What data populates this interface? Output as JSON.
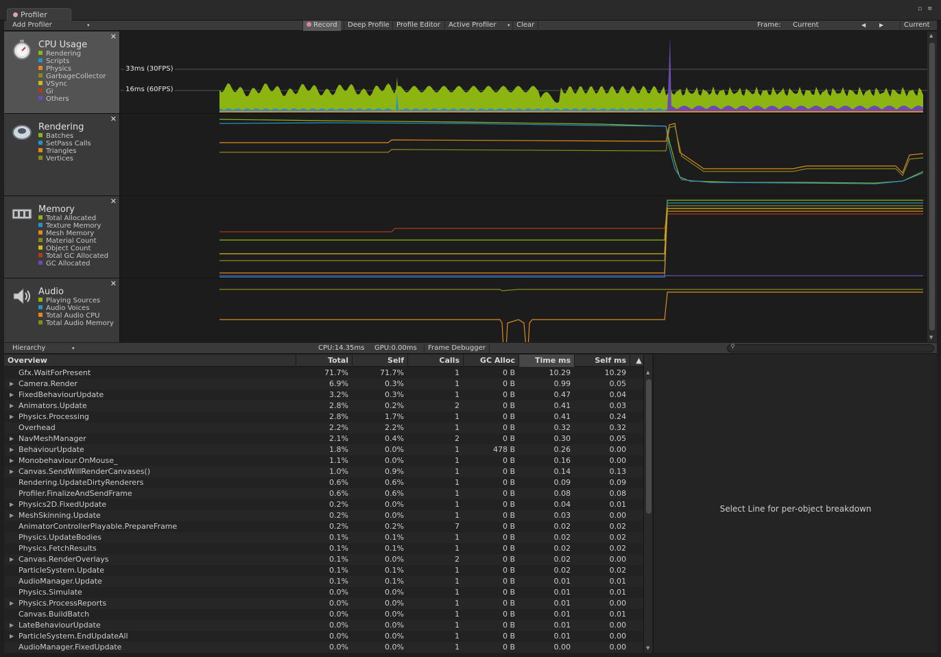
{
  "window": {
    "tab_title": "Profiler"
  },
  "toolbar": {
    "add_profiler": "Add Profiler",
    "record": "Record",
    "deep_profile": "Deep Profile",
    "profile_editor": "Profile Editor",
    "active_profiler": "Active Profiler",
    "clear": "Clear",
    "frame_label": "Frame:",
    "frame_value": "Current",
    "current_button": "Current"
  },
  "colors": {
    "green": "#8db512",
    "blue": "#2b8fc9",
    "orange": "#e08a1c",
    "olive": "#8a8a1a",
    "yellow": "#d4b81a",
    "red": "#b03a1a",
    "purple": "#6a4bb0"
  },
  "areas": [
    {
      "title": "CPU Usage",
      "icon": "cpu-stopwatch-icon",
      "items": [
        {
          "label": "Rendering",
          "color": "#8db512"
        },
        {
          "label": "Scripts",
          "color": "#2b8fc9"
        },
        {
          "label": "Physics",
          "color": "#e08a1c"
        },
        {
          "label": "GarbageCollector",
          "color": "#8a8a1a"
        },
        {
          "label": "VSync",
          "color": "#d4b81a"
        },
        {
          "label": "Gi",
          "color": "#b03a1a"
        },
        {
          "label": "Others",
          "color": "#6a4bb0"
        }
      ]
    },
    {
      "title": "Rendering",
      "icon": "rendering-icon",
      "items": [
        {
          "label": "Batches",
          "color": "#8db512"
        },
        {
          "label": "SetPass Calls",
          "color": "#2b8fc9"
        },
        {
          "label": "Triangles",
          "color": "#e08a1c"
        },
        {
          "label": "Vertices",
          "color": "#8a8a1a"
        }
      ]
    },
    {
      "title": "Memory",
      "icon": "memory-chip-icon",
      "items": [
        {
          "label": "Total Allocated",
          "color": "#8db512"
        },
        {
          "label": "Texture Memory",
          "color": "#2b8fc9"
        },
        {
          "label": "Mesh Memory",
          "color": "#e08a1c"
        },
        {
          "label": "Material Count",
          "color": "#8a8a1a"
        },
        {
          "label": "Object Count",
          "color": "#d4b81a"
        },
        {
          "label": "Total GC Allocated",
          "color": "#b03a1a"
        },
        {
          "label": "GC Allocated",
          "color": "#6a4bb0"
        }
      ]
    },
    {
      "title": "Audio",
      "icon": "speaker-icon",
      "items": [
        {
          "label": "Playing Sources",
          "color": "#8db512"
        },
        {
          "label": "Audio Voices",
          "color": "#2b8fc9"
        },
        {
          "label": "Total Audio CPU",
          "color": "#e08a1c"
        },
        {
          "label": "Total Audio Memory",
          "color": "#8a8a1a"
        }
      ]
    }
  ],
  "fps_lines": {
    "line_30": "33ms (30FPS)",
    "line_60": "16ms (60FPS)"
  },
  "hierarchy": {
    "view_mode": "Hierarchy",
    "cpu_stat": "CPU:14.35ms",
    "gpu_stat": "GPU:0.00ms",
    "frame_debugger": "Frame Debugger",
    "columns": [
      "Overview",
      "Total",
      "Self",
      "Calls",
      "GC Alloc",
      "Time ms",
      "Self ms"
    ],
    "rows": [
      {
        "expand": false,
        "name": "Gfx.WaitForPresent",
        "total": "71.7%",
        "self": "71.7%",
        "calls": "1",
        "gc": "0 B",
        "time": "10.29",
        "selfms": "10.29"
      },
      {
        "expand": true,
        "name": "Camera.Render",
        "total": "6.9%",
        "self": "0.3%",
        "calls": "1",
        "gc": "0 B",
        "time": "0.99",
        "selfms": "0.05"
      },
      {
        "expand": true,
        "name": "FixedBehaviourUpdate",
        "total": "3.2%",
        "self": "0.3%",
        "calls": "1",
        "gc": "0 B",
        "time": "0.47",
        "selfms": "0.04"
      },
      {
        "expand": true,
        "name": "Animators.Update",
        "total": "2.8%",
        "self": "0.2%",
        "calls": "2",
        "gc": "0 B",
        "time": "0.41",
        "selfms": "0.03"
      },
      {
        "expand": true,
        "name": "Physics.Processing",
        "total": "2.8%",
        "self": "1.7%",
        "calls": "1",
        "gc": "0 B",
        "time": "0.41",
        "selfms": "0.24"
      },
      {
        "expand": false,
        "name": "Overhead",
        "total": "2.2%",
        "self": "2.2%",
        "calls": "1",
        "gc": "0 B",
        "time": "0.32",
        "selfms": "0.32"
      },
      {
        "expand": true,
        "name": "NavMeshManager",
        "total": "2.1%",
        "self": "0.4%",
        "calls": "2",
        "gc": "0 B",
        "time": "0.30",
        "selfms": "0.05"
      },
      {
        "expand": true,
        "name": "BehaviourUpdate",
        "total": "1.8%",
        "self": "0.0%",
        "calls": "1",
        "gc": "478 B",
        "time": "0.26",
        "selfms": "0.00"
      },
      {
        "expand": true,
        "name": "Monobehaviour.OnMouse_",
        "total": "1.1%",
        "self": "0.0%",
        "calls": "1",
        "gc": "0 B",
        "time": "0.16",
        "selfms": "0.00"
      },
      {
        "expand": true,
        "name": "Canvas.SendWillRenderCanvases()",
        "total": "1.0%",
        "self": "0.9%",
        "calls": "1",
        "gc": "0 B",
        "time": "0.14",
        "selfms": "0.13"
      },
      {
        "expand": false,
        "name": "Rendering.UpdateDirtyRenderers",
        "total": "0.6%",
        "self": "0.6%",
        "calls": "1",
        "gc": "0 B",
        "time": "0.09",
        "selfms": "0.09"
      },
      {
        "expand": false,
        "name": "Profiler.FinalizeAndSendFrame",
        "total": "0.6%",
        "self": "0.6%",
        "calls": "1",
        "gc": "0 B",
        "time": "0.08",
        "selfms": "0.08"
      },
      {
        "expand": true,
        "name": "Physics2D.FixedUpdate",
        "total": "0.2%",
        "self": "0.0%",
        "calls": "1",
        "gc": "0 B",
        "time": "0.04",
        "selfms": "0.01"
      },
      {
        "expand": true,
        "name": "MeshSkinning.Update",
        "total": "0.2%",
        "self": "0.0%",
        "calls": "1",
        "gc": "0 B",
        "time": "0.03",
        "selfms": "0.00"
      },
      {
        "expand": false,
        "name": "AnimatorControllerPlayable.PrepareFrame",
        "total": "0.2%",
        "self": "0.2%",
        "calls": "7",
        "gc": "0 B",
        "time": "0.02",
        "selfms": "0.02"
      },
      {
        "expand": false,
        "name": "Physics.UpdateBodies",
        "total": "0.1%",
        "self": "0.1%",
        "calls": "1",
        "gc": "0 B",
        "time": "0.02",
        "selfms": "0.02"
      },
      {
        "expand": false,
        "name": "Physics.FetchResults",
        "total": "0.1%",
        "self": "0.1%",
        "calls": "1",
        "gc": "0 B",
        "time": "0.02",
        "selfms": "0.02"
      },
      {
        "expand": true,
        "name": "Canvas.RenderOverlays",
        "total": "0.1%",
        "self": "0.0%",
        "calls": "2",
        "gc": "0 B",
        "time": "0.02",
        "selfms": "0.00"
      },
      {
        "expand": false,
        "name": "ParticleSystem.Update",
        "total": "0.1%",
        "self": "0.1%",
        "calls": "1",
        "gc": "0 B",
        "time": "0.02",
        "selfms": "0.02"
      },
      {
        "expand": false,
        "name": "AudioManager.Update",
        "total": "0.1%",
        "self": "0.1%",
        "calls": "1",
        "gc": "0 B",
        "time": "0.01",
        "selfms": "0.01"
      },
      {
        "expand": false,
        "name": "Physics.Simulate",
        "total": "0.0%",
        "self": "0.0%",
        "calls": "1",
        "gc": "0 B",
        "time": "0.01",
        "selfms": "0.01"
      },
      {
        "expand": true,
        "name": "Physics.ProcessReports",
        "total": "0.0%",
        "self": "0.0%",
        "calls": "1",
        "gc": "0 B",
        "time": "0.01",
        "selfms": "0.00"
      },
      {
        "expand": false,
        "name": "Canvas.BuildBatch",
        "total": "0.0%",
        "self": "0.0%",
        "calls": "1",
        "gc": "0 B",
        "time": "0.01",
        "selfms": "0.01"
      },
      {
        "expand": true,
        "name": "LateBehaviourUpdate",
        "total": "0.0%",
        "self": "0.0%",
        "calls": "1",
        "gc": "0 B",
        "time": "0.01",
        "selfms": "0.00"
      },
      {
        "expand": true,
        "name": "ParticleSystem.EndUpdateAll",
        "total": "0.0%",
        "self": "0.0%",
        "calls": "1",
        "gc": "0 B",
        "time": "0.01",
        "selfms": "0.00"
      },
      {
        "expand": false,
        "name": "AudioManager.FixedUpdate",
        "total": "0.0%",
        "self": "0.0%",
        "calls": "1",
        "gc": "0 B",
        "time": "0.00",
        "selfms": "0.00"
      }
    ]
  },
  "detail": {
    "message": "Select Line for per-object breakdown"
  }
}
